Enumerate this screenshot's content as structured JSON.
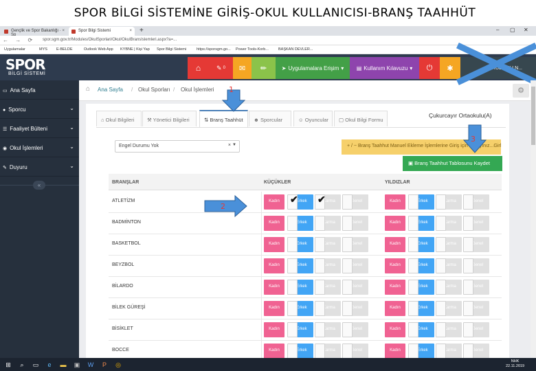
{
  "slide_title": "SPOR BİLGİ SİSTEMİNE GİRİŞ-OKUL KULLANICISI-BRANŞ TAAHHÜT",
  "browser": {
    "tab1": "Gençlik ve Spor Bakanlığı · Sp",
    "tab2": "Spor Bilgi Sistemi",
    "url": "spor.sgm.gov.tr/Modules/OkulSporlari/Okul/OkulBransIslemleri.aspx?a=...",
    "bookmarks": [
      "Uygulamalar",
      "MYS",
      "E-BELDE",
      "Outlook Web App",
      "KYBNE | Kişi Yap",
      "Spor Bilgi Sistemi",
      "https://sporsgm.go...",
      "Power Tools-Korb...",
      "BAŞKAN DEVLER..."
    ]
  },
  "header": {
    "logo_main": "SPOR",
    "logo_sub": "BİLGİ SİSTEMİ",
    "notif_count": "0",
    "apps_label": "Uygulamalara Erişim",
    "guide_label": "Kullanım Kılavuzu",
    "user_label": "OKUL KULLN..."
  },
  "sidebar": {
    "items": [
      {
        "label": "Ana Sayfa",
        "icon": "desktop-icon",
        "chev": false
      },
      {
        "label": "Sporcu",
        "icon": "users-icon",
        "chev": true
      },
      {
        "label": "Faaliyet Bülteni",
        "icon": "list-icon",
        "chev": true
      },
      {
        "label": "Okul İşlemleri",
        "icon": "globe-icon",
        "chev": true
      },
      {
        "label": "Duyuru",
        "icon": "edit-icon",
        "chev": true
      }
    ],
    "collapse": "«"
  },
  "breadcrumb": [
    "Ana Sayfa",
    "Okul Sporları",
    "Okul İşlemleri"
  ],
  "tabs": [
    {
      "label": "Okul Bilgileri",
      "active": false
    },
    {
      "label": "Yönetici Bilgileri",
      "active": false
    },
    {
      "label": "Branş Taahhüt",
      "active": true
    },
    {
      "label": "Sporcular",
      "active": false
    },
    {
      "label": "Oyuncular",
      "active": false
    },
    {
      "label": "Okul Bilgi Formu",
      "active": false
    }
  ],
  "school_name": "Çukurcayır Ortaokulu(A)",
  "filter": {
    "value": "Engel Durumu Yok",
    "clear": "×"
  },
  "manual_button": "+ / − Branş Taahhut Manuel Ekleme İşlemlerine Giriş için Tıklayınız...Girle",
  "save_button": "Branş Taahhut Tablosunu Kaydet",
  "table": {
    "headers": {
      "brans": "BRANŞLAR",
      "kucukler": "KÜÇÜKLER",
      "yildizlar": "YILDIZLAR"
    },
    "cell_labels": {
      "kadin": "Kadın",
      "erkek": "Erkek",
      "karma": "Karma",
      "genel": "Genel"
    },
    "rows": [
      "ATLETİZM",
      "BADMİNTON",
      "BASKETBOL",
      "BEYZBOL",
      "BİLARDO",
      "BİLEK GÜREŞİ",
      "BİSİKLET",
      "BOCCE"
    ]
  },
  "annotations": {
    "n1": "1",
    "n2": "2",
    "n3": "3"
  },
  "taskbar": {
    "time": "NHK\n22.11.2019"
  },
  "colors": {
    "kadin": "#f06292",
    "erkek": "#42a5f5",
    "save": "#34a853",
    "manual": "#f6d06b",
    "sidebar": "#26303d"
  }
}
